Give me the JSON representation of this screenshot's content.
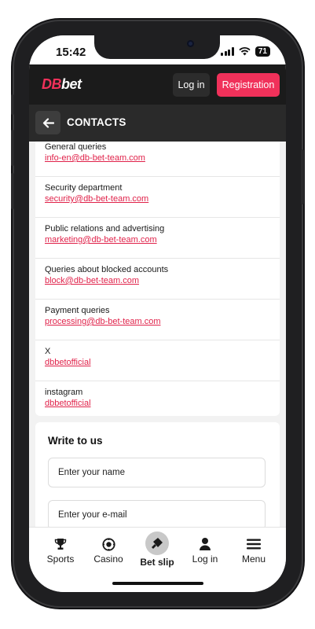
{
  "status": {
    "time": "15:42",
    "battery": "71"
  },
  "header": {
    "logo_a": "DB",
    "logo_b": "bet",
    "login_label": "Log in",
    "registration_label": "Registration"
  },
  "colors": {
    "accent": "#f0315a",
    "link": "#e0224a",
    "dark": "#1b1b1b"
  },
  "page": {
    "title": "CONTACTS",
    "back_icon": "arrow-left-icon"
  },
  "contacts": [
    {
      "label": "General queries",
      "value": "info-en@db-bet-team.com"
    },
    {
      "label": "Security department",
      "value": "security@db-bet-team.com"
    },
    {
      "label": "Public relations and advertising",
      "value": "marketing@db-bet-team.com"
    },
    {
      "label": "Queries about blocked accounts",
      "value": "block@db-bet-team.com"
    },
    {
      "label": "Payment queries",
      "value": "processing@db-bet-team.com"
    },
    {
      "label": "X",
      "value": "dbbetofficial"
    },
    {
      "label": "instagram",
      "value": "dbbetofficial"
    }
  ],
  "write": {
    "title": "Write to us",
    "name_placeholder": "Enter your name",
    "email_placeholder": "Enter your e-mail"
  },
  "nav": [
    {
      "label": "Sports",
      "icon": "trophy-icon"
    },
    {
      "label": "Casino",
      "icon": "casino-chip-icon"
    },
    {
      "label": "Bet slip",
      "icon": "ticket-icon"
    },
    {
      "label": "Log in",
      "icon": "user-icon"
    },
    {
      "label": "Menu",
      "icon": "menu-icon"
    }
  ]
}
